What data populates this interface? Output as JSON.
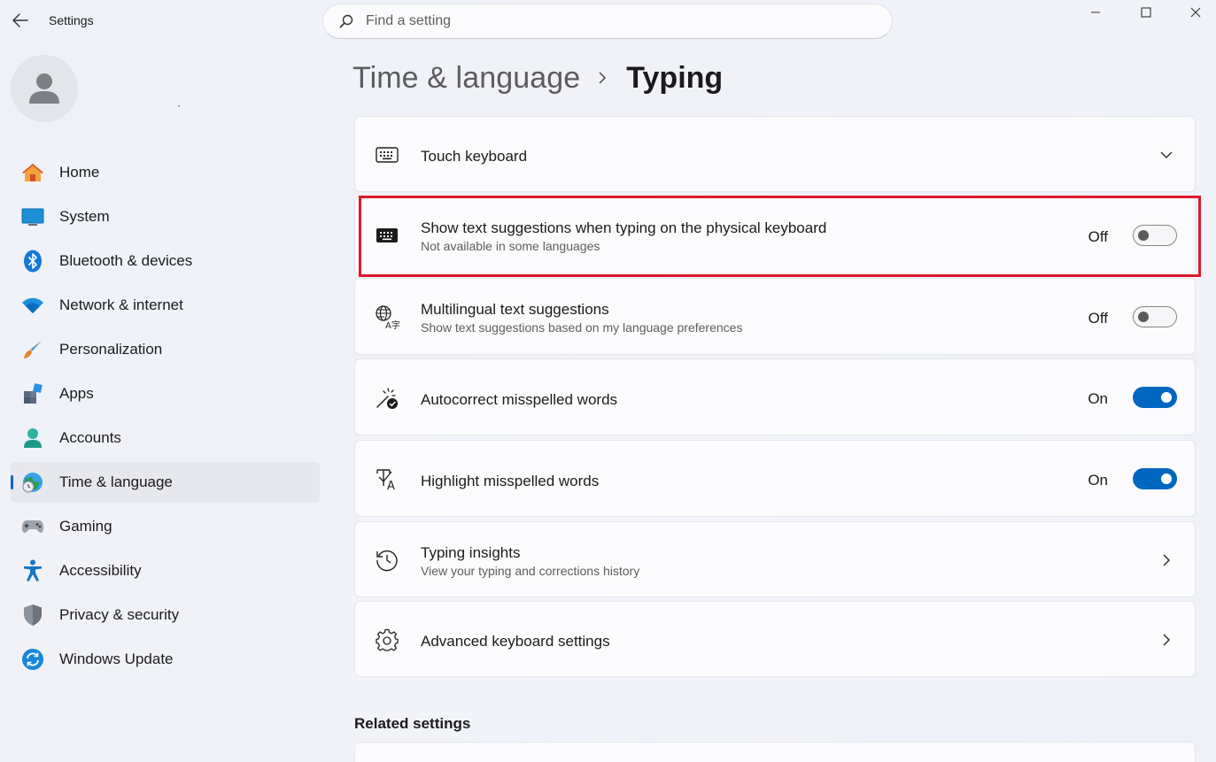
{
  "window": {
    "app_title": "Settings",
    "search_placeholder": "Find a setting"
  },
  "sidebar": {
    "items": [
      {
        "label": "Home",
        "icon": "home-icon"
      },
      {
        "label": "System",
        "icon": "system-icon"
      },
      {
        "label": "Bluetooth & devices",
        "icon": "bluetooth-icon"
      },
      {
        "label": "Network & internet",
        "icon": "wifi-icon"
      },
      {
        "label": "Personalization",
        "icon": "brush-icon"
      },
      {
        "label": "Apps",
        "icon": "apps-icon"
      },
      {
        "label": "Accounts",
        "icon": "accounts-icon"
      },
      {
        "label": "Time & language",
        "icon": "globe-clock-icon",
        "active": true
      },
      {
        "label": "Gaming",
        "icon": "gamepad-icon"
      },
      {
        "label": "Accessibility",
        "icon": "accessibility-icon"
      },
      {
        "label": "Privacy & security",
        "icon": "shield-icon"
      },
      {
        "label": "Windows Update",
        "icon": "update-icon"
      }
    ]
  },
  "breadcrumb": {
    "parent": "Time & language",
    "current": "Typing"
  },
  "settings": {
    "touch_keyboard": {
      "title": "Touch keyboard",
      "icon": "keyboard-icon"
    },
    "text_suggestions": {
      "title": "Show text suggestions when typing on the physical keyboard",
      "subtitle": "Not available in some languages",
      "state": "Off",
      "icon": "keyboard-filled-icon"
    },
    "multilingual": {
      "title": "Multilingual text suggestions",
      "subtitle": "Show text suggestions based on my language preferences",
      "state": "Off",
      "icon": "language-icon"
    },
    "autocorrect": {
      "title": "Autocorrect misspelled words",
      "state": "On",
      "icon": "autocorrect-icon"
    },
    "highlight": {
      "title": "Highlight misspelled words",
      "state": "On",
      "icon": "spellcheck-icon"
    },
    "insights": {
      "title": "Typing insights",
      "subtitle": "View your typing and corrections history",
      "icon": "history-icon"
    },
    "advanced": {
      "title": "Advanced keyboard settings",
      "icon": "gear-icon"
    }
  },
  "related": {
    "heading": "Related settings"
  },
  "colors": {
    "accent": "#0067c0",
    "highlight_border": "#e0182b"
  }
}
